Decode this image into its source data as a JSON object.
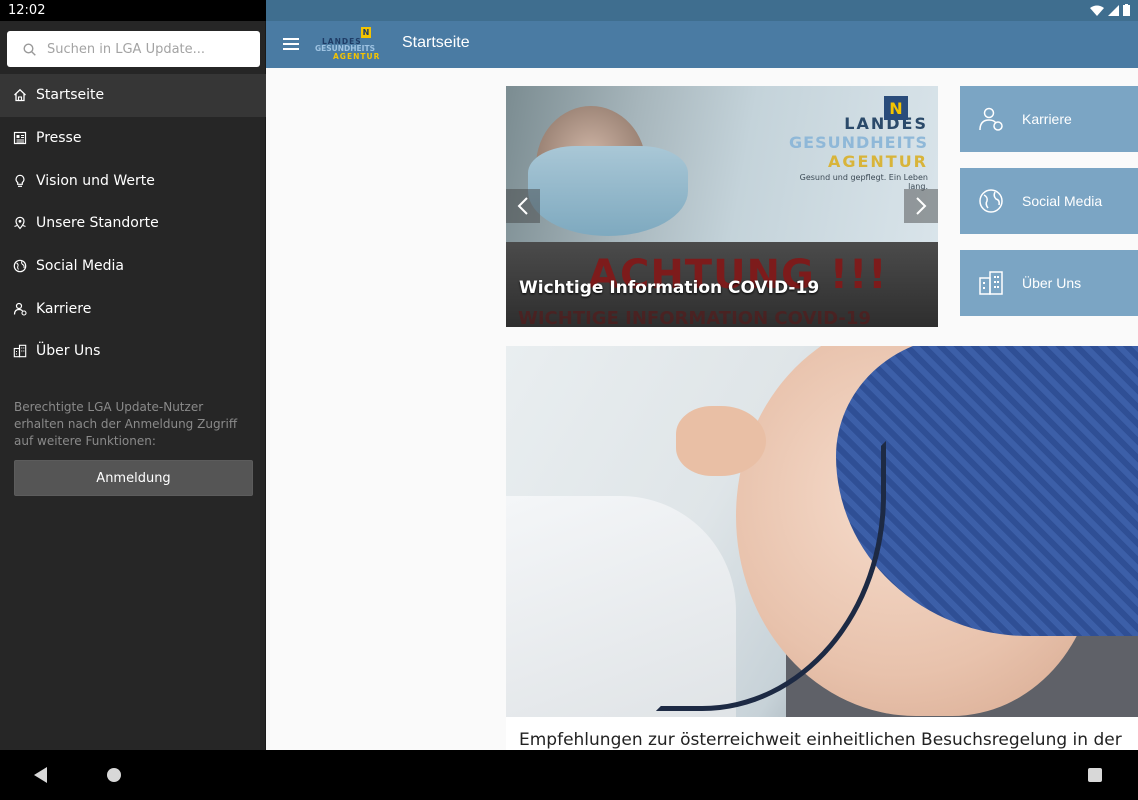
{
  "status": {
    "time": "12:02"
  },
  "app_bar": {
    "title": "Startseite",
    "logo": {
      "line1": "LANDES",
      "line2": "GESUNDHEITS",
      "line3": "AGENTUR",
      "badge": "N"
    }
  },
  "drawer": {
    "search_placeholder": "Suchen in LGA Update...",
    "items": [
      {
        "label": "Startseite",
        "icon": "home-icon",
        "active": true
      },
      {
        "label": "Presse",
        "icon": "newspaper-icon"
      },
      {
        "label": "Vision und Werte",
        "icon": "lightbulb-icon"
      },
      {
        "label": "Unsere Standorte",
        "icon": "map-pin-icon"
      },
      {
        "label": "Social Media",
        "icon": "globe-icon"
      },
      {
        "label": "Karriere",
        "icon": "person-badge-icon"
      },
      {
        "label": "Über Uns",
        "icon": "buildings-icon"
      }
    ],
    "note": "Berechtigte LGA Update-Nutzer erhalten nach der Anmeldung Zugriff auf weitere Funktionen:",
    "login_label": "Anmeldung"
  },
  "slider": {
    "caption": "Wichtige Information COVID-19",
    "banner_text": "ACHTUNG !!!",
    "banner_sub": "WICHTIGE INFORMATION COVID-19",
    "brand": {
      "line1": "LANDES",
      "line2": "GESUNDHEITS",
      "line3": "AGENTUR",
      "tagline": "Gesund und gepflegt. Ein Leben lang.",
      "badge": "N"
    }
  },
  "tiles": [
    {
      "label": "Karriere",
      "icon": "person-badge-icon"
    },
    {
      "label": "Social Media",
      "icon": "globe-icon"
    },
    {
      "label": "Über Uns",
      "icon": "buildings-icon"
    }
  ],
  "article": {
    "title": "Empfehlungen zur österreichweit einheitlichen Besuchsregelung in der"
  },
  "colors": {
    "app_bar": "#4a7ba3",
    "tile": "#7ba5c4",
    "drawer": "#262626"
  }
}
